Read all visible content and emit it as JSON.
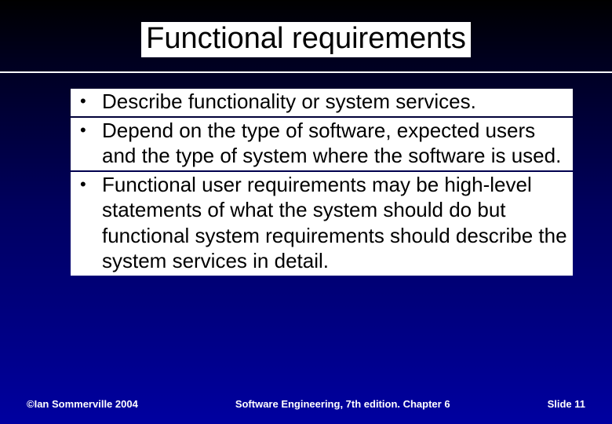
{
  "slide": {
    "title": "Functional requirements",
    "bullets": [
      "Describe functionality or system services.",
      "Depend on the type of software, expected users and the type of system where the software is used.",
      "Functional user requirements may be high-level statements of what the system should do but functional system requirements should describe the system services in detail."
    ],
    "footer": {
      "left": "©Ian Sommerville 2004",
      "center": "Software Engineering, 7th edition. Chapter 6",
      "right": "Slide  11"
    }
  }
}
